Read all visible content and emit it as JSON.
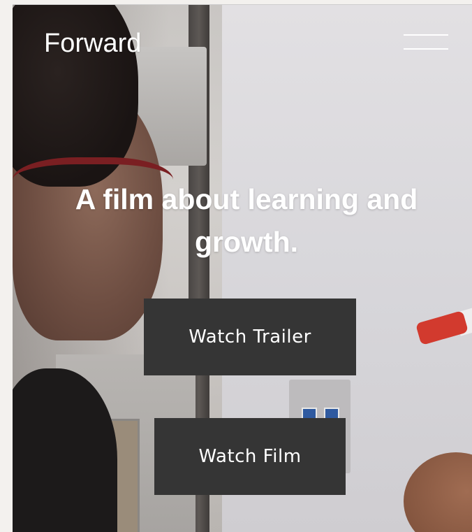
{
  "brand": {
    "name": "Forward"
  },
  "menu": {
    "icon": "hamburger-menu-icon"
  },
  "hero": {
    "headline": "A film about learning and growth.",
    "buttons": [
      {
        "label": "Watch Trailer"
      },
      {
        "label": "Watch Film"
      }
    ]
  },
  "colors": {
    "button_bg": "#353535",
    "text": "#ffffff",
    "page_bg": "#f3f1ee"
  }
}
